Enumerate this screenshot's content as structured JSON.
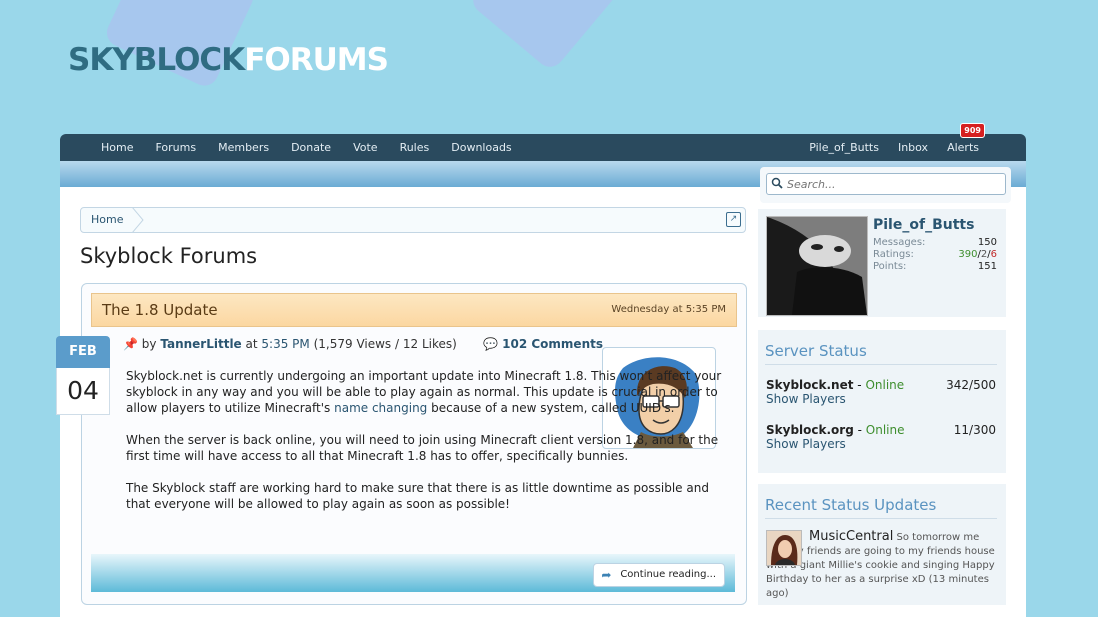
{
  "logo": {
    "part1": "SKYBLOCK",
    "part2": "FORUMS"
  },
  "nav": {
    "left": [
      "Home",
      "Forums",
      "Members",
      "Donate",
      "Vote",
      "Rules",
      "Downloads"
    ],
    "user": "Pile_of_Butts",
    "inbox": "Inbox",
    "alerts": "Alerts",
    "alerts_count": "909"
  },
  "breadcrumb": {
    "home": "Home"
  },
  "page_title": "Skyblock Forums",
  "post": {
    "title": "The 1.8 Update",
    "time": "Wednesday at 5:35 PM",
    "by": "by",
    "author": "TannerLittle",
    "at": "at",
    "posted_time": "5:35 PM",
    "views_likes": "(1,579 Views / 12 Likes)",
    "comments": "102 Comments",
    "date_month": "FEB",
    "date_day": "04",
    "p1_a": "Skyblock.net is currently undergoing an important update into Minecraft 1.8. This won't affect your skyblock in any way and you will be able to play again as normal. This update is crucial in order to allow players to utilize Minecraft's ",
    "p1_link": "name changing",
    "p1_b": " because of a new system, called UUID's.",
    "p2": "When the server is back online, you will need to join using Minecraft client version 1.8, and for the first time will have access to all that Minecraft 1.8 has to offer, specifically bunnies.",
    "p3": "The Skyblock staff are working hard to make sure that there is as little downtime as possible and that everyone will be allowed to play again as soon as possible!",
    "continue": "Continue reading..."
  },
  "search": {
    "placeholder": "Search..."
  },
  "visitor": {
    "name": "Pile_of_Butts",
    "messages_label": "Messages:",
    "messages": "150",
    "ratings_label": "Ratings:",
    "ratings_pos": "390",
    "ratings_neu": "2",
    "ratings_neg": "6",
    "points_label": "Points:",
    "points": "151"
  },
  "server_status": {
    "title": "Server Status",
    "servers": [
      {
        "name": "Skyblock.net",
        "status": "Online",
        "count": "342/500",
        "show": "Show Players"
      },
      {
        "name": "Skyblock.org",
        "status": "Online",
        "count": "11/300",
        "show": "Show Players"
      }
    ]
  },
  "recent_status": {
    "title": "Recent Status Updates",
    "user": "MusicCentral",
    "text": "So tomorrow me and my friends are going to my friends house with a giant Millie's cookie and singing Happy Birthday to her as a surprise xD",
    "ago": "(13 minutes ago)"
  },
  "colors": {
    "background": "#9ad7ea",
    "navbar": "#2a4a5e",
    "link": "#2a5571",
    "online": "#3e8e2e"
  }
}
